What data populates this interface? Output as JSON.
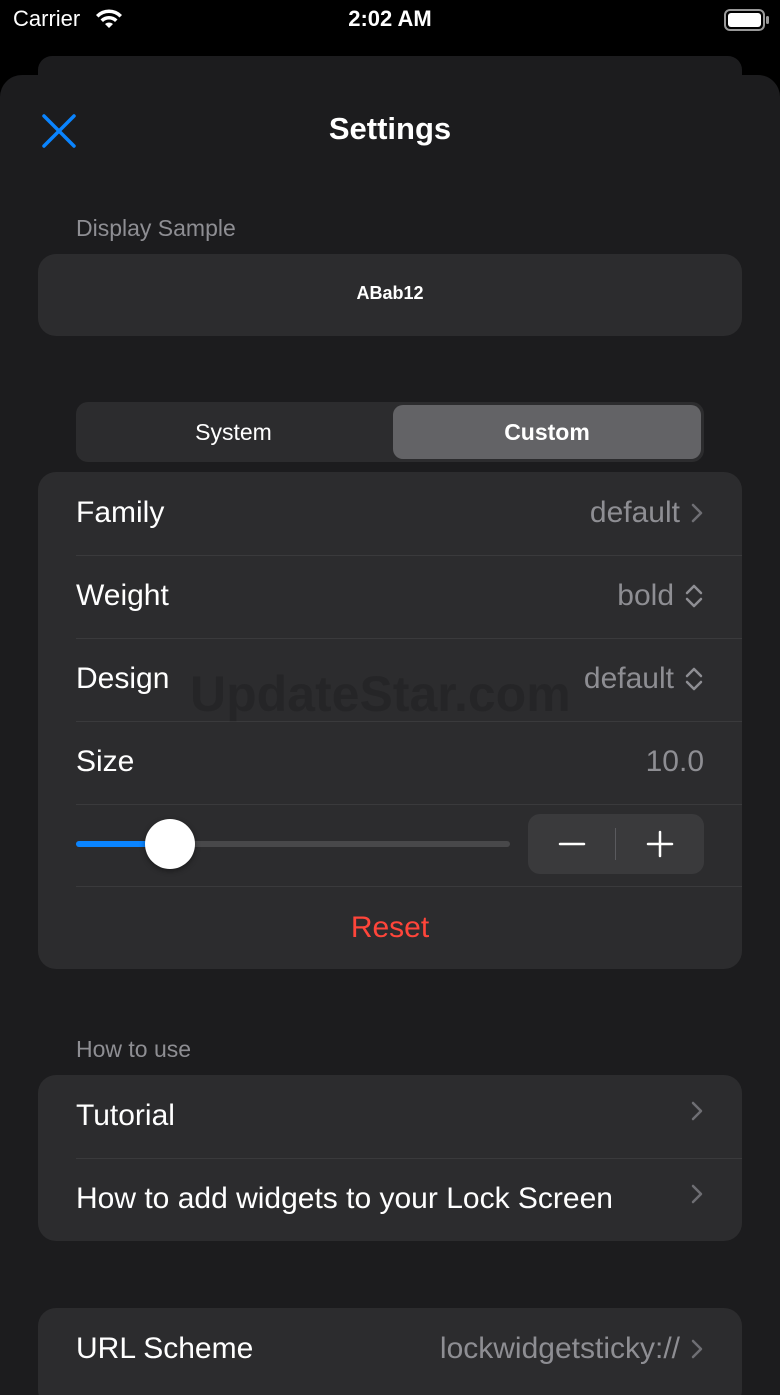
{
  "status": {
    "carrier": "Carrier",
    "time": "2:02 AM"
  },
  "header": {
    "title": "Settings",
    "close_icon": "close-icon"
  },
  "display_sample": {
    "section_label": "Display Sample",
    "sample": "ABab12"
  },
  "segmented": {
    "system": "System",
    "custom": "Custom",
    "selected": "Custom"
  },
  "font": {
    "family": {
      "label": "Family",
      "value": "default"
    },
    "weight": {
      "label": "Weight",
      "value": "bold"
    },
    "design": {
      "label": "Design",
      "value": "default"
    },
    "size": {
      "label": "Size",
      "value": "10.0"
    },
    "slider_fraction": 0.16,
    "reset": "Reset"
  },
  "how_to_use": {
    "section_label": "How to use",
    "items": [
      {
        "label": "Tutorial"
      },
      {
        "label": "How to add widgets to your Lock Screen"
      }
    ]
  },
  "url_scheme": {
    "label": "URL Scheme",
    "value": "lockwidgetsticky://"
  },
  "watermark": "UpdateStar.com",
  "colors": {
    "accent": "#0a84ff",
    "destructive": "#ff453a",
    "background": "#1c1c1e",
    "card": "#2c2c2e",
    "secondary_text": "#8e8e93"
  }
}
